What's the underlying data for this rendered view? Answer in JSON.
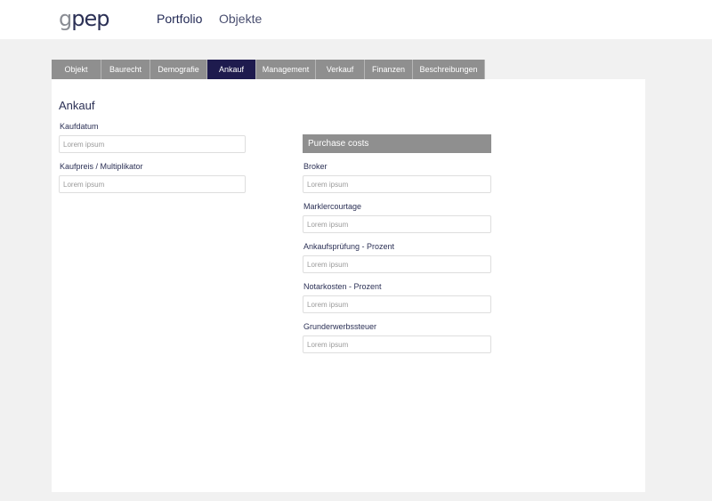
{
  "header": {
    "logo": {
      "g": "g",
      "rest": "pep"
    },
    "nav": [
      "Portfolio",
      "Objekte"
    ]
  },
  "tabs": [
    {
      "label": "Objekt",
      "active": false
    },
    {
      "label": "Baurecht",
      "active": false
    },
    {
      "label": "Demografie",
      "active": false
    },
    {
      "label": "Ankauf",
      "active": true
    },
    {
      "label": "Management",
      "active": false
    },
    {
      "label": "Verkauf",
      "active": false
    },
    {
      "label": "Finanzen",
      "active": false
    },
    {
      "label": "Beschreibungen",
      "active": false
    }
  ],
  "section": {
    "title": "Ankauf"
  },
  "left_fields": [
    {
      "label": "Kaufdatum",
      "placeholder": "Lorem ipsum",
      "value": ""
    },
    {
      "label": "Kaufpreis / Multiplikator",
      "placeholder": "Lorem ipsum",
      "value": ""
    }
  ],
  "purchase_costs": {
    "header": "Purchase costs",
    "fields": [
      {
        "label": "Broker",
        "placeholder": "Lorem ipsum",
        "value": ""
      },
      {
        "label": "Marklercourtage",
        "placeholder": "Lorem ipsum",
        "value": ""
      },
      {
        "label": "Ankaufsprüfung - Prozent",
        "placeholder": "Lorem ipsum",
        "value": ""
      },
      {
        "label": "Notarkosten - Prozent",
        "placeholder": "Lorem ipsum",
        "value": ""
      },
      {
        "label": "Grunderwerbssteuer",
        "placeholder": "Lorem ipsum",
        "value": ""
      }
    ]
  }
}
